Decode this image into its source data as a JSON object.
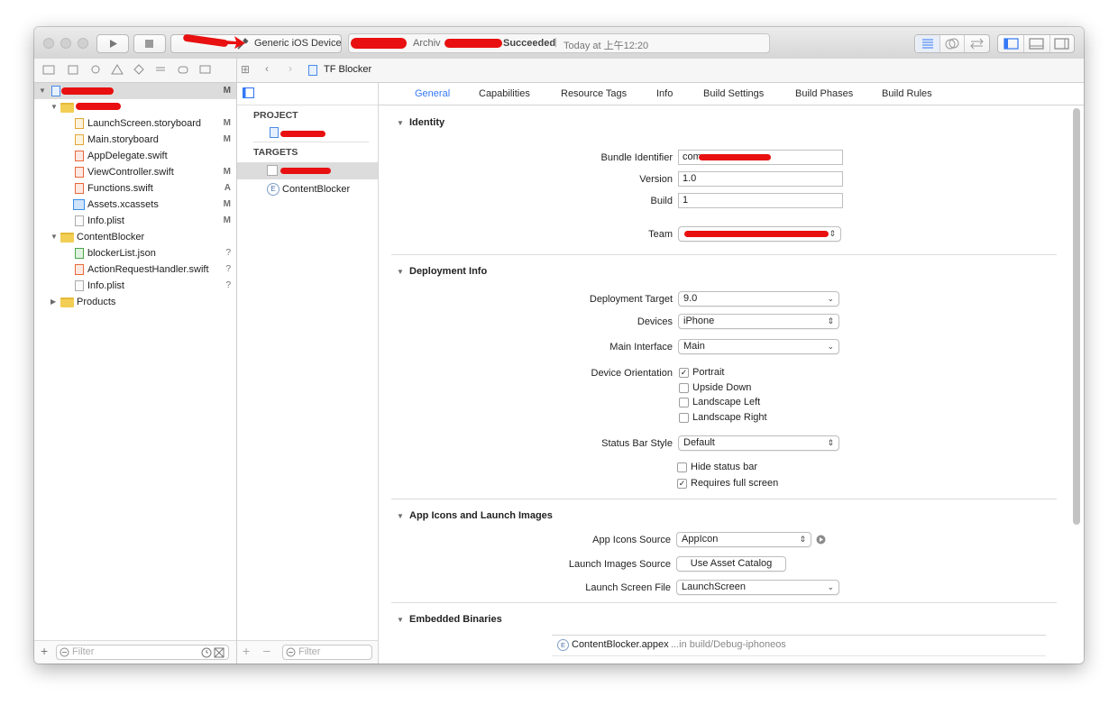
{
  "toolbar": {
    "scheme_device": "Generic iOS Device",
    "activity_prefix": "Archiv",
    "activity_status": "Succeeded",
    "activity_time": "Today at 上午12:20"
  },
  "pathbar": {
    "project_name": "TF Blocker"
  },
  "navigator": {
    "project_badge": "M",
    "files": [
      {
        "name": "LaunchScreen.storyboard",
        "badge": "M"
      },
      {
        "name": "Main.storyboard",
        "badge": "M"
      },
      {
        "name": "AppDelegate.swift",
        "badge": ""
      },
      {
        "name": "ViewController.swift",
        "badge": "M"
      },
      {
        "name": "Functions.swift",
        "badge": "A"
      },
      {
        "name": "Assets.xcassets",
        "badge": "M"
      },
      {
        "name": "Info.plist",
        "badge": "M"
      }
    ],
    "content_blocker_group": "ContentBlocker",
    "cb_files": [
      {
        "name": "blockerList.json",
        "badge": "?"
      },
      {
        "name": "ActionRequestHandler.swift",
        "badge": "?"
      },
      {
        "name": "Info.plist",
        "badge": "?"
      }
    ],
    "products_group": "Products",
    "filter_placeholder": "Filter"
  },
  "targets_panel": {
    "project_header": "PROJECT",
    "targets_header": "TARGETS",
    "content_blocker_target": "ContentBlocker",
    "filter_placeholder": "Filter"
  },
  "tabs": [
    "General",
    "Capabilities",
    "Resource Tags",
    "Info",
    "Build Settings",
    "Build Phases",
    "Build Rules"
  ],
  "identity": {
    "header": "Identity",
    "bundle_identifier_label": "Bundle Identifier",
    "bundle_identifier_value": "com",
    "version_label": "Version",
    "version_value": "1.0",
    "build_label": "Build",
    "build_value": "1",
    "team_label": "Team"
  },
  "deployment": {
    "header": "Deployment Info",
    "target_label": "Deployment Target",
    "target_value": "9.0",
    "devices_label": "Devices",
    "devices_value": "iPhone",
    "main_interface_label": "Main Interface",
    "main_interface_value": "Main",
    "orientation_label": "Device Orientation",
    "orientations": [
      {
        "label": "Portrait",
        "checked": true
      },
      {
        "label": "Upside Down",
        "checked": false
      },
      {
        "label": "Landscape Left",
        "checked": false
      },
      {
        "label": "Landscape Right",
        "checked": false
      }
    ],
    "status_bar_label": "Status Bar Style",
    "status_bar_value": "Default",
    "hide_status_bar": "Hide status bar",
    "requires_full_screen": "Requires full screen"
  },
  "app_icons": {
    "header": "App Icons and Launch Images",
    "icons_source_label": "App Icons Source",
    "icons_source_value": "AppIcon",
    "launch_images_label": "Launch Images Source",
    "launch_images_button": "Use Asset Catalog",
    "launch_screen_label": "Launch Screen File",
    "launch_screen_value": "LaunchScreen"
  },
  "embedded": {
    "header": "Embedded Binaries",
    "item_name": "ContentBlocker.appex",
    "item_path": "...in build/Debug-iphoneos"
  }
}
